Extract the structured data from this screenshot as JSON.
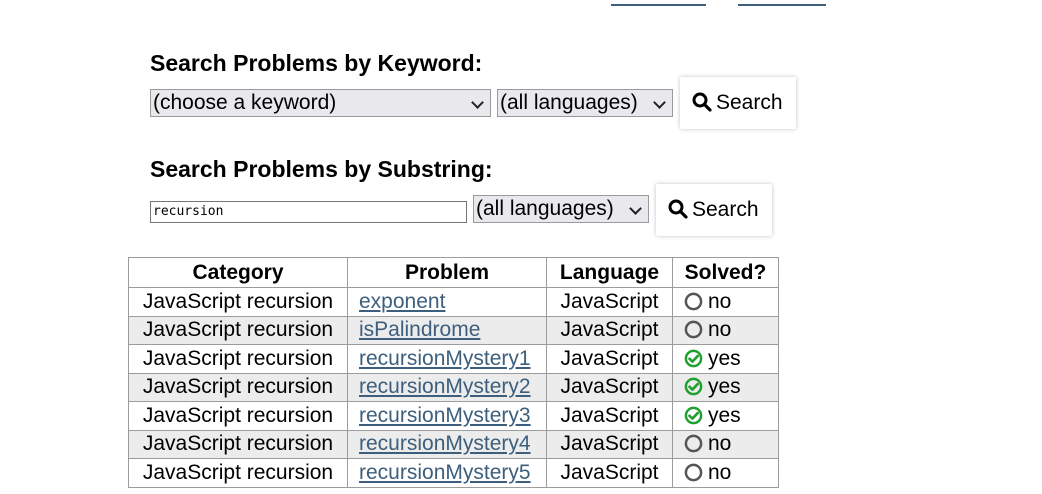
{
  "keyword_search": {
    "heading": "Search Problems by Keyword:",
    "keyword_select_value": "(choose a keyword)",
    "language_select_value": "(all languages)",
    "button_label": "Search"
  },
  "substring_search": {
    "heading": "Search Problems by Substring:",
    "input_value": "recursion",
    "language_select_value": "(all languages)",
    "button_label": "Search"
  },
  "results": {
    "columns": [
      "Category",
      "Problem",
      "Language",
      "Solved?"
    ],
    "rows": [
      {
        "category": "JavaScript recursion",
        "problem": "exponent",
        "language": "JavaScript",
        "solved": "no"
      },
      {
        "category": "JavaScript recursion",
        "problem": "isPalindrome",
        "language": "JavaScript",
        "solved": "no"
      },
      {
        "category": "JavaScript recursion",
        "problem": "recursionMystery1",
        "language": "JavaScript",
        "solved": "yes"
      },
      {
        "category": "JavaScript recursion",
        "problem": "recursionMystery2",
        "language": "JavaScript",
        "solved": "yes"
      },
      {
        "category": "JavaScript recursion",
        "problem": "recursionMystery3",
        "language": "JavaScript",
        "solved": "yes"
      },
      {
        "category": "JavaScript recursion",
        "problem": "recursionMystery4",
        "language": "JavaScript",
        "solved": "no"
      },
      {
        "category": "JavaScript recursion",
        "problem": "recursionMystery5",
        "language": "JavaScript",
        "solved": "no"
      }
    ]
  },
  "icons": {
    "search": "search-icon",
    "solved_yes": "check-circle-icon",
    "solved_no": "empty-circle-icon"
  },
  "colors": {
    "link": "#3d5f7d",
    "solved_yes": "#1fa02f",
    "solved_no": "#555555",
    "alt_row": "#ececec"
  }
}
